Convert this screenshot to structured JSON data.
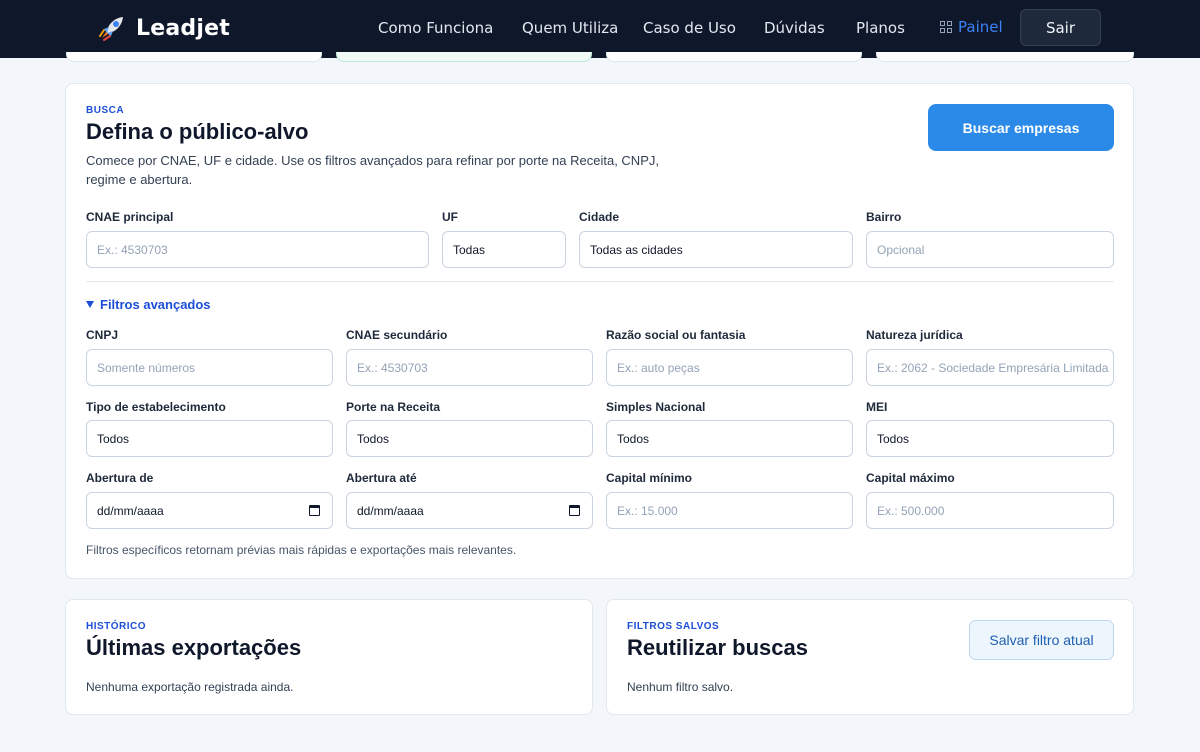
{
  "header": {
    "brand": "Leadjet",
    "nav": [
      "Como Funciona",
      "Quem Utiliza",
      "Caso de Uso",
      "Dúvidas",
      "Planos"
    ],
    "panel_label": "Painel",
    "logout_label": "Sair"
  },
  "search": {
    "eyebrow": "BUSCA",
    "title": "Defina o público-alvo",
    "description": "Comece por CNAE, UF e cidade. Use os filtros avançados para refinar por porte na Receita, CNPJ, regime e abertura.",
    "submit_label": "Buscar empresas",
    "basic": {
      "cnae": {
        "label": "CNAE principal",
        "placeholder": "Ex.: 4530703"
      },
      "uf": {
        "label": "UF",
        "value": "Todas"
      },
      "cidade": {
        "label": "Cidade",
        "value": "Todas as cidades"
      },
      "bairro": {
        "label": "Bairro",
        "placeholder": "Opcional"
      }
    },
    "advanced_toggle": "Filtros avançados",
    "advanced": {
      "cnpj": {
        "label": "CNPJ",
        "placeholder": "Somente números"
      },
      "cnae_sec": {
        "label": "CNAE secundário",
        "placeholder": "Ex.: 4530703"
      },
      "razao": {
        "label": "Razão social ou fantasia",
        "placeholder": "Ex.: auto peças"
      },
      "natureza": {
        "label": "Natureza jurídica",
        "placeholder": "Ex.: 2062 - Sociedade Empresária Limitada"
      },
      "tipo": {
        "label": "Tipo de estabelecimento",
        "value": "Todos"
      },
      "porte": {
        "label": "Porte na Receita",
        "value": "Todos"
      },
      "simples": {
        "label": "Simples Nacional",
        "value": "Todos"
      },
      "mei": {
        "label": "MEI",
        "value": "Todos"
      },
      "abertura_de": {
        "label": "Abertura de",
        "value": "dd/mm/aaaa"
      },
      "abertura_ate": {
        "label": "Abertura até",
        "value": "dd/mm/aaaa"
      },
      "capital_min": {
        "label": "Capital mínimo",
        "placeholder": "Ex.: 15.000"
      },
      "capital_max": {
        "label": "Capital máximo",
        "placeholder": "Ex.: 500.000"
      }
    },
    "note": "Filtros específicos retornam prévias mais rápidas e exportações mais relevantes."
  },
  "history": {
    "eyebrow": "HISTÓRICO",
    "title": "Últimas exportações",
    "empty": "Nenhuma exportação registrada ainda."
  },
  "saved": {
    "eyebrow": "FILTROS SALVOS",
    "title": "Reutilizar buscas",
    "save_label": "Salvar filtro atual",
    "empty": "Nenhum filtro salvo."
  }
}
